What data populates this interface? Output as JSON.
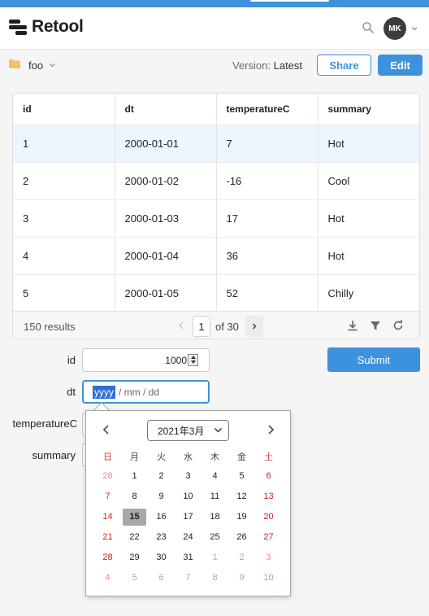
{
  "app": {
    "logo_text": "Retool",
    "avatar_initials": "MK",
    "app_name": "foo"
  },
  "toolbar": {
    "version_label": "Version:",
    "version_value": "Latest",
    "share_label": "Share",
    "edit_label": "Edit"
  },
  "table": {
    "columns": [
      "id",
      "dt",
      "temperatureC",
      "summary"
    ],
    "rows": [
      [
        "1",
        "2000-01-01",
        "7",
        "Hot"
      ],
      [
        "2",
        "2000-01-02",
        "-16",
        "Cool"
      ],
      [
        "3",
        "2000-01-03",
        "17",
        "Hot"
      ],
      [
        "4",
        "2000-01-04",
        "36",
        "Hot"
      ],
      [
        "5",
        "2000-01-05",
        "52",
        "Chilly"
      ]
    ],
    "results": "150 results",
    "page": "1",
    "of_pages": "of 30"
  },
  "form": {
    "id_label": "id",
    "id_value": "1000",
    "dt_label": "dt",
    "dt_year_placeholder": "yyyy",
    "dt_rest_placeholder": "/ mm / dd",
    "temp_label": "temperatureC",
    "summary_label": "summary",
    "submit_label": "Submit"
  },
  "datepicker": {
    "month_label": "2021年3月",
    "weekdays": [
      "日",
      "月",
      "火",
      "水",
      "木",
      "金",
      "土"
    ],
    "weeks": [
      [
        "28",
        "1",
        "2",
        "3",
        "4",
        "5",
        "6"
      ],
      [
        "7",
        "8",
        "9",
        "10",
        "11",
        "12",
        "13"
      ],
      [
        "14",
        "15",
        "16",
        "17",
        "18",
        "19",
        "20"
      ],
      [
        "21",
        "22",
        "23",
        "24",
        "25",
        "26",
        "27"
      ],
      [
        "28",
        "29",
        "30",
        "31",
        "1",
        "2",
        "3"
      ],
      [
        "4",
        "5",
        "6",
        "7",
        "8",
        "9",
        "10"
      ]
    ],
    "selected_day": "15"
  },
  "colors": {
    "accent": "#3c92dc",
    "selected_row": "#edf5fd",
    "weekend_red": "#d01f1f"
  },
  "icons": [
    "search-icon",
    "chevron-down-icon",
    "folder-icon",
    "download-icon",
    "filter-icon",
    "refresh-icon",
    "chevron-left-icon",
    "chevron-right-icon"
  ]
}
